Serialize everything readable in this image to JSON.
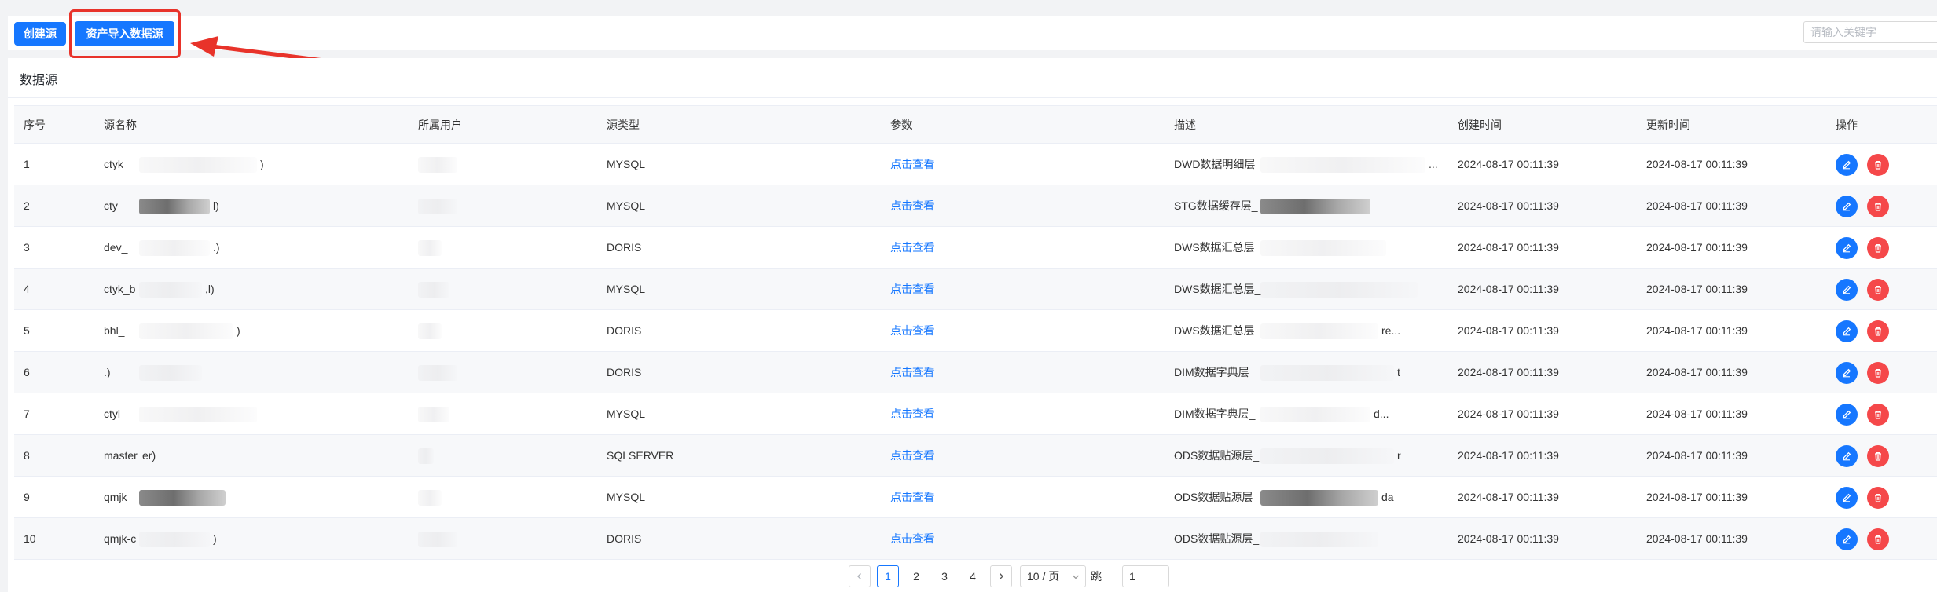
{
  "toolbar": {
    "create_label": "创建源",
    "import_label": "资产导入数据源",
    "search_placeholder": "请输入关键字"
  },
  "colors": {
    "primary": "#1677ff",
    "danger": "#f5484a",
    "annotation": "#e8332a"
  },
  "panel": {
    "title": "数据源"
  },
  "table": {
    "headers": [
      "序号",
      "源名称",
      "所属用户",
      "源类型",
      "参数",
      "描述",
      "创建时间",
      "更新时间",
      "操作"
    ],
    "rows": [
      {
        "index": "1",
        "name": "ctyk",
        "type": "MYSQL",
        "param": "点击查看",
        "desc": "DWD数据明细层",
        "desc_tail": "...",
        "created": "2024-08-17 00:11:39",
        "updated": "2024-08-17 00:11:39"
      },
      {
        "index": "2",
        "name": "cty",
        "type": "MYSQL",
        "param": "点击查看",
        "desc": "STG数据缓存层_",
        "desc_tail": "",
        "created": "2024-08-17 00:11:39",
        "updated": "2024-08-17 00:11:39"
      },
      {
        "index": "3",
        "name": "dev_",
        "type": "DORIS",
        "param": "点击查看",
        "desc": "DWS数据汇总层",
        "desc_tail": "",
        "created": "2024-08-17 00:11:39",
        "updated": "2024-08-17 00:11:39"
      },
      {
        "index": "4",
        "name": "ctyk_b",
        "type": "MYSQL",
        "param": "点击查看",
        "desc": "DWS数据汇总层_",
        "desc_tail": "",
        "created": "2024-08-17 00:11:39",
        "updated": "2024-08-17 00:11:39"
      },
      {
        "index": "5",
        "name": "bhl_",
        "type": "DORIS",
        "param": "点击查看",
        "desc": "DWS数据汇总层",
        "desc_tail": "re...",
        "created": "2024-08-17 00:11:39",
        "updated": "2024-08-17 00:11:39"
      },
      {
        "index": "6",
        "name": ".)",
        "type": "DORIS",
        "param": "点击查看",
        "desc": "DIM数据字典层",
        "desc_tail": "t",
        "created": "2024-08-17 00:11:39",
        "updated": "2024-08-17 00:11:39"
      },
      {
        "index": "7",
        "name": "ctyl",
        "type": "MYSQL",
        "param": "点击查看",
        "desc": "DIM数据字典层_",
        "desc_tail": "d...",
        "created": "2024-08-17 00:11:39",
        "updated": "2024-08-17 00:11:39"
      },
      {
        "index": "8",
        "name": "master",
        "type": "SQLSERVER",
        "param": "点击查看",
        "desc": "ODS数据贴源层_",
        "desc_tail": "r",
        "created": "2024-08-17 00:11:39",
        "updated": "2024-08-17 00:11:39"
      },
      {
        "index": "9",
        "name": "qmjk",
        "type": "MYSQL",
        "param": "点击查看",
        "desc": "ODS数据贴源层",
        "desc_tail": "da",
        "created": "2024-08-17 00:11:39",
        "updated": "2024-08-17 00:11:39"
      },
      {
        "index": "10",
        "name": "qmjk-c",
        "type": "DORIS",
        "param": "点击查看",
        "desc": "ODS数据贴源层_",
        "desc_tail": "",
        "created": "2024-08-17 00:11:39",
        "updated": "2024-08-17 00:11:39"
      }
    ],
    "name_suffixes": [
      ")",
      "l)",
      ".)",
      ",l)",
      ")",
      "",
      "",
      "er)",
      "",
      ")"
    ]
  },
  "pagination": {
    "pages": [
      "1",
      "2",
      "3",
      "4"
    ],
    "current": "1",
    "page_size": "10 / 页",
    "jump_label": "跳至",
    "jump_value": "1",
    "prev_icon": "chevron-left-icon",
    "next_icon": "chevron-right-icon"
  }
}
